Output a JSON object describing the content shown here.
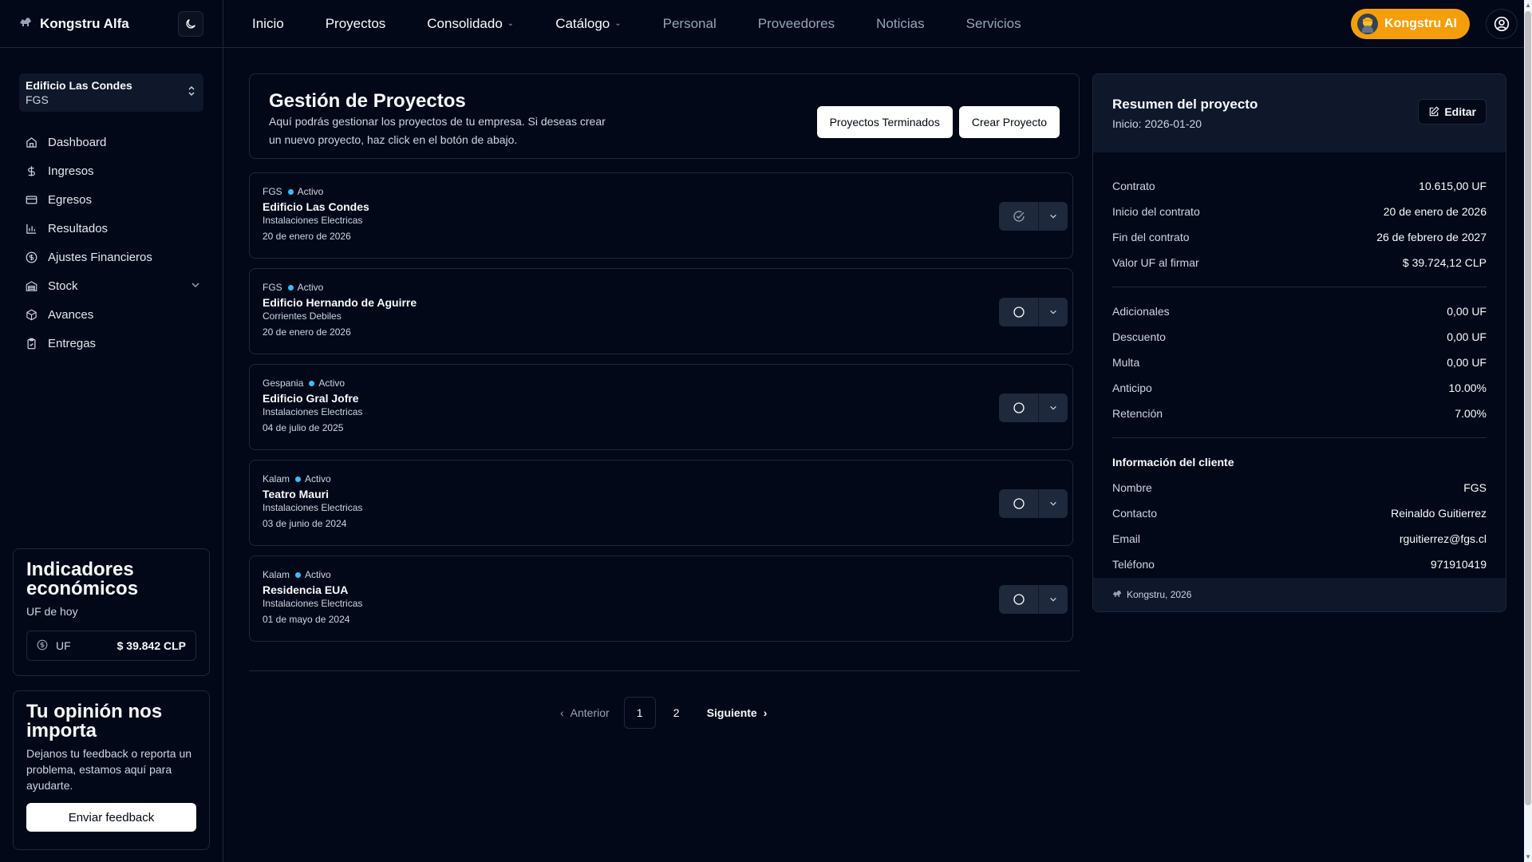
{
  "brand": {
    "name": "Kongstru Alfa"
  },
  "project_selector": {
    "name": "Edificio Las Condes",
    "client": "FGS"
  },
  "sidebar": {
    "items": [
      {
        "label": "Dashboard"
      },
      {
        "label": "Ingresos"
      },
      {
        "label": "Egresos"
      },
      {
        "label": "Resultados"
      },
      {
        "label": "Ajustes Financieros"
      },
      {
        "label": "Stock"
      },
      {
        "label": "Avances"
      },
      {
        "label": "Entregas"
      }
    ]
  },
  "economic": {
    "title": "Indicadores económicos",
    "subtitle": "UF de hoy",
    "uf_label": "UF",
    "uf_value": "$ 39.842 CLP"
  },
  "feedback": {
    "title": "Tu opinión nos importa",
    "text": "Dejanos tu feedback o reporta un problema, estamos aquí para ayudarte.",
    "button": "Enviar feedback"
  },
  "topnav": {
    "items": [
      {
        "label": "Inicio"
      },
      {
        "label": "Proyectos"
      },
      {
        "label": "Consolidado"
      },
      {
        "label": "Catálogo"
      },
      {
        "label": "Personal"
      },
      {
        "label": "Proveedores"
      },
      {
        "label": "Noticias"
      },
      {
        "label": "Servicios"
      }
    ],
    "ai_button": "Kongstru AI"
  },
  "header": {
    "title": "Gestión de Proyectos",
    "description": "Aquí podrás gestionar los proyectos de tu empresa. Si deseas crear un nuevo proyecto, haz click en el botón de abajo.",
    "btn_finished": "Proyectos Terminados",
    "btn_create": "Crear Proyecto"
  },
  "projects": [
    {
      "client": "FGS",
      "status": "Activo",
      "name": "Edificio Las Condes",
      "type": "Instalaciones Electricas",
      "date": "20 de enero de 2026"
    },
    {
      "client": "FGS",
      "status": "Activo",
      "name": "Edificio Hernando de Aguirre",
      "type": "Corrientes Debiles",
      "date": "20 de enero de 2026"
    },
    {
      "client": "Gespania",
      "status": "Activo",
      "name": "Edificio Gral Jofre",
      "type": "Instalaciones Electricas",
      "date": "04 de julio de 2025"
    },
    {
      "client": "Kalam",
      "status": "Activo",
      "name": "Teatro Mauri",
      "type": "Instalaciones Electricas",
      "date": "03 de junio de 2024"
    },
    {
      "client": "Kalam",
      "status": "Activo",
      "name": "Residencia EUA",
      "type": "Instalaciones Electricas",
      "date": "01 de mayo de 2024"
    }
  ],
  "pagination": {
    "prev": "Anterior",
    "next": "Siguiente",
    "pages": [
      "1",
      "2"
    ],
    "current": "1"
  },
  "summary": {
    "title": "Resumen del proyecto",
    "start": "Inicio: 2026-01-20",
    "edit": "Editar",
    "contract": [
      {
        "k": "Contrato",
        "v": "10.615,00 UF"
      },
      {
        "k": "Inicio del contrato",
        "v": "20 de enero de 2026"
      },
      {
        "k": "Fin del contrato",
        "v": "26 de febrero de 2027"
      },
      {
        "k": "Valor UF al firmar",
        "v": "$ 39.724,12 CLP"
      }
    ],
    "adjustments": [
      {
        "k": "Adicionales",
        "v": "0,00 UF"
      },
      {
        "k": "Descuento",
        "v": "0,00 UF"
      },
      {
        "k": "Multa",
        "v": "0,00 UF"
      },
      {
        "k": "Anticipo",
        "v": "10.00%"
      },
      {
        "k": "Retención",
        "v": "7.00%"
      }
    ],
    "client_title": "Información del cliente",
    "client": [
      {
        "k": "Nombre",
        "v": "FGS"
      },
      {
        "k": "Contacto",
        "v": "Reinaldo Guitierrez"
      },
      {
        "k": "Email",
        "v": "rguitierrez@fgs.cl"
      },
      {
        "k": "Teléfono",
        "v": "971910419"
      }
    ],
    "footer": "Kongstru, 2026"
  },
  "colors": {
    "background": "#020817",
    "border": "#1e293b",
    "accent_ai": "#f59e0b",
    "status_dot": "#38bdf8"
  }
}
